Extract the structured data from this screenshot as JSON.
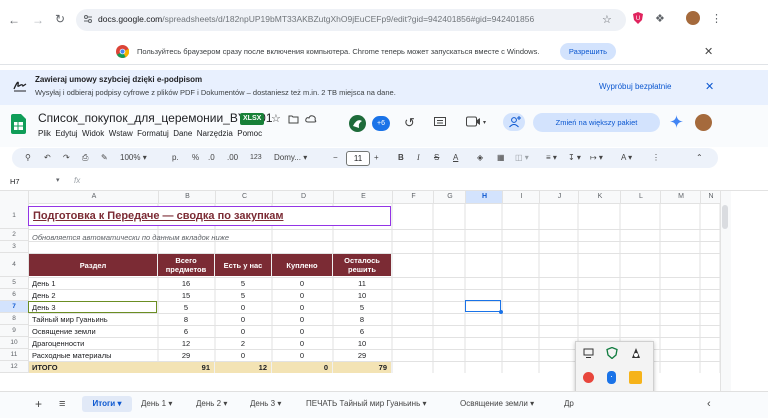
{
  "browser": {
    "url_host": "docs.google.com",
    "url_path": "/spreadsheets/d/182npUP19bMT33AKBZutgXhO9jEuCEFp9/edit?gid=942401856#gid=942401856",
    "profile_initial": ""
  },
  "infobar": {
    "text": "Пользуйтесь браузером сразу после включения компьютера. Chrome теперь может запускаться вместе с Windows.",
    "allow_label": "Разрешить"
  },
  "banner": {
    "title": "Zawieraj umowy szybciej dzięki e-podpisom",
    "text": "Wysyłaj i odbieraj podpisy cyfrowe z plików PDF i Dokumentów – dostaniesz też m.in. 2 TB miejsca na dane.",
    "cta": "Wypróbuj bezpłatnie"
  },
  "doc": {
    "title": "Список_покупок_для_церемонии_BY_001",
    "badge": "XLSX",
    "menus": [
      "Plik",
      "Edytuj",
      "Widok",
      "Wstaw",
      "Formatuj",
      "Dane",
      "Narzędzia",
      "Pomoc"
    ],
    "avatar_count": "+6",
    "upgrade_label": "Zmień na większy pakiet"
  },
  "toolbar": {
    "zoom": "100%",
    "currency": "р.",
    "percent": "%",
    "dec_minus": ".0",
    "dec_plus": ".00",
    "format_123": "123",
    "font": "Domy...",
    "font_size": "11",
    "bold": "B",
    "italic": "I",
    "strike": "S",
    "text_color": "A"
  },
  "formula": {
    "cell_ref": "H7",
    "fx": "fx",
    "value": ""
  },
  "columns": [
    "A",
    "B",
    "C",
    "D",
    "E",
    "F",
    "G",
    "H",
    "I",
    "J",
    "K",
    "L",
    "M",
    "N"
  ],
  "rows": [
    "1",
    "2",
    "3",
    "4",
    "5",
    "6",
    "7",
    "8",
    "9",
    "10",
    "11",
    "12"
  ],
  "sheet": {
    "title": "Подготовка к Передаче — сводка по закупкам",
    "subtitle": "Обновляется автоматически по данным вкладок ниже",
    "headers": [
      "Раздел",
      "Всего предметов",
      "Есть у нас",
      "Куплено",
      "Осталось решить"
    ],
    "data": [
      [
        "День 1",
        "16",
        "5",
        "0",
        "11"
      ],
      [
        "День 2",
        "15",
        "5",
        "0",
        "10"
      ],
      [
        "День 3",
        "5",
        "0",
        "0",
        "5"
      ],
      [
        "Тайный мир Гуаньинь",
        "8",
        "0",
        "0",
        "8"
      ],
      [
        "Освящение земли",
        "6",
        "0",
        "0",
        "6"
      ],
      [
        "Драгоценности",
        "12",
        "2",
        "0",
        "10"
      ],
      [
        "Расходные материалы",
        "29",
        "0",
        "0",
        "29"
      ]
    ],
    "total": [
      "ИТОГО",
      "91",
      "12",
      "0",
      "79"
    ]
  },
  "tabs": {
    "active": "Итоги",
    "items": [
      "День 1",
      "День 2",
      "День 3",
      "ПЕЧАТЬ Тайный мир Гуаньинь",
      "Освящение земли",
      "Др"
    ]
  },
  "colors": {
    "header_fill": "#7b2b34",
    "title_color": "#7b2b34",
    "total_fill": "#f3e3b4",
    "accent": "#0b57d0"
  }
}
